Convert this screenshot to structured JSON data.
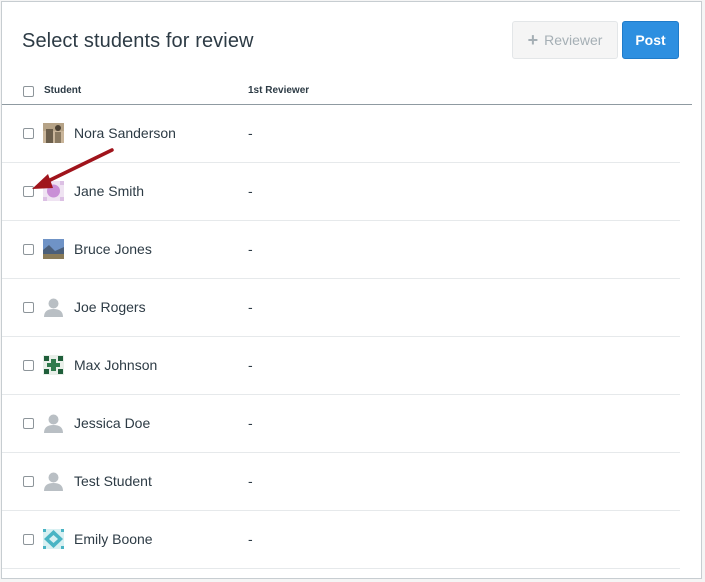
{
  "dialog": {
    "title": "Select students for review",
    "reviewer_button_label": "Reviewer",
    "post_button_label": "Post"
  },
  "table": {
    "columns": [
      "Student",
      "1st Reviewer"
    ],
    "rows": [
      {
        "name": "Nora Sanderson",
        "reviewer": "-",
        "avatar": "photo-avatar"
      },
      {
        "name": "Jane Smith",
        "reviewer": "-",
        "avatar": "purple-pattern-avatar"
      },
      {
        "name": "Bruce Jones",
        "reviewer": "-",
        "avatar": "landscape-avatar"
      },
      {
        "name": "Joe Rogers",
        "reviewer": "-",
        "avatar": "default-user-avatar"
      },
      {
        "name": "Max Johnson",
        "reviewer": "-",
        "avatar": "green-pattern-avatar"
      },
      {
        "name": "Jessica Doe",
        "reviewer": "-",
        "avatar": "default-user-avatar"
      },
      {
        "name": "Test Student",
        "reviewer": "-",
        "avatar": "default-user-avatar"
      },
      {
        "name": "Emily Boone",
        "reviewer": "-",
        "avatar": "teal-pattern-avatar"
      }
    ]
  },
  "colors": {
    "accent": "#2d8fe0",
    "annotation_arrow": "#a0141c"
  }
}
